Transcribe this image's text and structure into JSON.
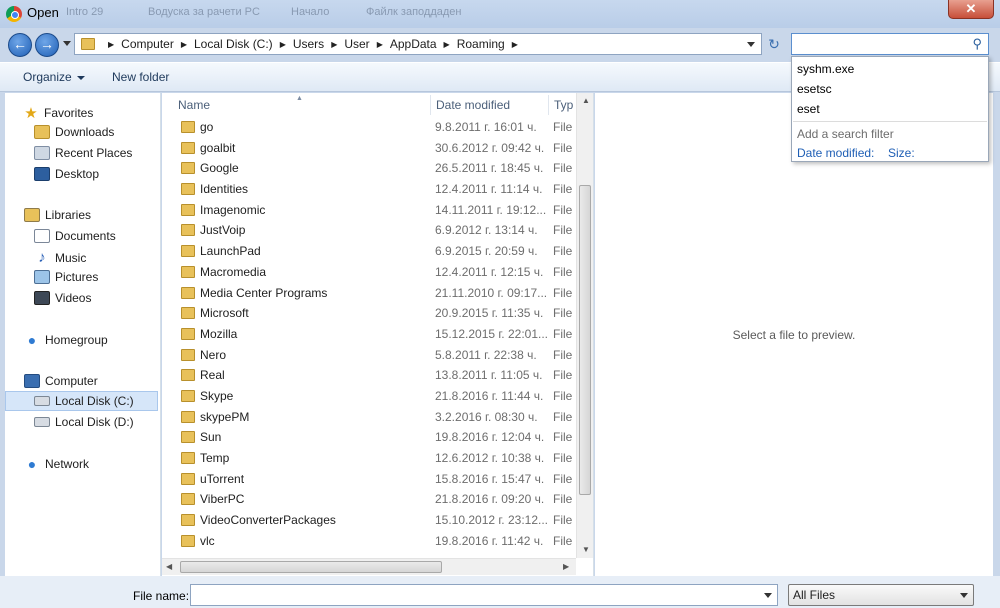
{
  "window": {
    "title": "Open",
    "background_tabs": [
      "Intro 29",
      "Водуска за рачети PC",
      "Начало",
      "Файлк заподдаден"
    ],
    "close_glyph": "✕"
  },
  "nav": {
    "back_glyph": "←",
    "forward_glyph": "→",
    "breadcrumbs": [
      "Computer",
      "Local Disk (C:)",
      "Users",
      "User",
      "AppData",
      "Roaming"
    ],
    "refresh_glyph": "↻"
  },
  "search": {
    "value": "",
    "suggestions": [
      "syshm.exe",
      "esetsc",
      "eset"
    ],
    "filter_hint": "Add a search filter",
    "filter_date": "Date modified:",
    "filter_size": "Size:"
  },
  "toolbar": {
    "organize_label": "Organize",
    "new_folder_label": "New folder"
  },
  "sidebar": {
    "favorites_label": "Favorites",
    "favorites": [
      "Downloads",
      "Recent Places",
      "Desktop"
    ],
    "libraries_label": "Libraries",
    "libraries": [
      "Documents",
      "Music",
      "Pictures",
      "Videos"
    ],
    "homegroup_label": "Homegroup",
    "computer_label": "Computer",
    "drives": [
      "Local Disk (C:)",
      "Local Disk (D:)"
    ],
    "network_label": "Network"
  },
  "filelist": {
    "columns": [
      "Name",
      "Date modified",
      "Typ"
    ],
    "rows": [
      {
        "name": "go",
        "date": "9.8.2011 г. 16:01 ч.",
        "type": "File"
      },
      {
        "name": "goalbit",
        "date": "30.6.2012 г. 09:42 ч.",
        "type": "File"
      },
      {
        "name": "Google",
        "date": "26.5.2011 г. 18:45 ч.",
        "type": "File"
      },
      {
        "name": "Identities",
        "date": "12.4.2011 г. 11:14 ч.",
        "type": "File"
      },
      {
        "name": "Imagenomic",
        "date": "14.11.2011 г. 19:12...",
        "type": "File"
      },
      {
        "name": "JustVoip",
        "date": "6.9.2012 г. 13:14 ч.",
        "type": "File"
      },
      {
        "name": "LaunchPad",
        "date": "6.9.2015 г. 20:59 ч.",
        "type": "File"
      },
      {
        "name": "Macromedia",
        "date": "12.4.2011 г. 12:15 ч.",
        "type": "File"
      },
      {
        "name": "Media Center Programs",
        "date": "21.11.2010 г. 09:17...",
        "type": "File"
      },
      {
        "name": "Microsoft",
        "date": "20.9.2015 г. 11:35 ч.",
        "type": "File"
      },
      {
        "name": "Mozilla",
        "date": "15.12.2015 г. 22:01...",
        "type": "File"
      },
      {
        "name": "Nero",
        "date": "5.8.2011 г. 22:38 ч.",
        "type": "File"
      },
      {
        "name": "Real",
        "date": "13.8.2011 г. 11:05 ч.",
        "type": "File"
      },
      {
        "name": "Skype",
        "date": "21.8.2016 г. 11:44 ч.",
        "type": "File"
      },
      {
        "name": "skypePM",
        "date": "3.2.2016 г. 08:30 ч.",
        "type": "File"
      },
      {
        "name": "Sun",
        "date": "19.8.2016 г. 12:04 ч.",
        "type": "File"
      },
      {
        "name": "Temp",
        "date": "12.6.2012 г. 10:38 ч.",
        "type": "File"
      },
      {
        "name": "uTorrent",
        "date": "15.8.2016 г. 15:47 ч.",
        "type": "File"
      },
      {
        "name": "ViberPC",
        "date": "21.8.2016 г. 09:20 ч.",
        "type": "File"
      },
      {
        "name": "VideoConverterPackages",
        "date": "15.10.2012 г. 23:12...",
        "type": "File"
      },
      {
        "name": "vlc",
        "date": "19.8.2016 г. 11:42 ч.",
        "type": "File"
      }
    ]
  },
  "preview": {
    "message": "Select a file to preview."
  },
  "bottom": {
    "file_name_label": "File name:",
    "file_name_value": "",
    "file_type": "All Files"
  }
}
